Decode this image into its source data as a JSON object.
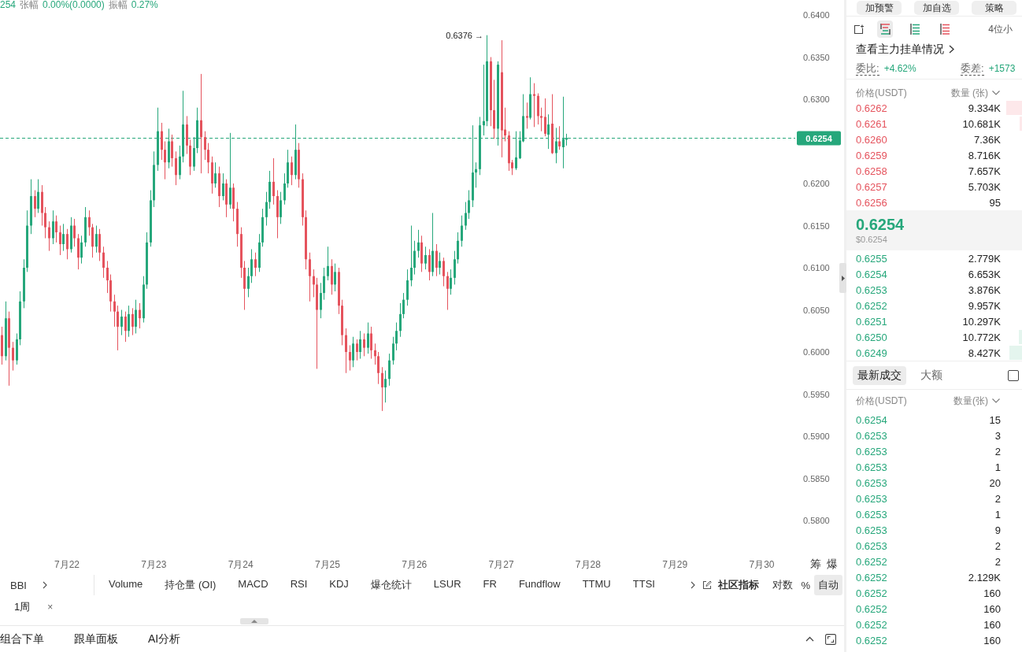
{
  "header": {
    "last": "254",
    "change_label": "张幅",
    "change": "0.00%(0.0000)",
    "amplitude_label": "振幅",
    "amplitude": "0.27%"
  },
  "chart": {
    "chart_data": [
      {
        "type": "candlestick",
        "x": [
          "--07-21T06:00",
          "--07-21T07:00",
          "--07-21T08:00",
          "--07-21T09:00",
          "--07-21T10:00",
          "--07-21T11:00",
          "--07-21T12:00",
          "--07-21T13:00",
          "--07-21T14:00",
          "--07-21T15:00",
          "--07-21T16:00",
          "--07-21T17:00",
          "--07-21T18:00",
          "--07-21T19:00",
          "--07-21T20:00",
          "--07-21T21:00",
          "--07-21T22:00",
          "--07-21T23:00",
          "--07-22T00:00",
          "--07-22T01:00",
          "--07-22T02:00",
          "--07-22T03:00",
          "--07-22T04:00",
          "--07-22T05:00",
          "--07-22T06:00",
          "--07-22T07:00",
          "--07-22T08:00",
          "--07-22T09:00",
          "--07-22T10:00",
          "--07-22T11:00",
          "--07-22T12:00",
          "--07-22T13:00",
          "--07-22T14:00",
          "--07-22T15:00",
          "--07-22T16:00",
          "--07-22T17:00",
          "--07-22T18:00",
          "--07-22T19:00",
          "--07-22T20:00",
          "--07-22T21:00",
          "--07-22T22:00",
          "--07-22T23:00",
          "--07-23T00:00",
          "--07-23T01:00",
          "--07-23T02:00",
          "--07-23T03:00",
          "--07-23T04:00",
          "--07-23T05:00",
          "--07-23T06:00",
          "--07-23T07:00",
          "--07-23T08:00",
          "--07-23T09:00",
          "--07-23T10:00",
          "--07-23T11:00",
          "--07-23T12:00",
          "--07-23T13:00",
          "--07-23T14:00",
          "--07-23T15:00",
          "--07-23T16:00",
          "--07-23T17:00",
          "--07-23T18:00",
          "--07-23T19:00",
          "--07-23T20:00",
          "--07-23T21:00",
          "--07-23T22:00",
          "--07-23T23:00",
          "--07-24T00:00",
          "--07-24T01:00",
          "--07-24T02:00",
          "--07-24T03:00",
          "--07-24T04:00",
          "--07-24T05:00",
          "--07-24T06:00",
          "--07-24T07:00",
          "--07-24T08:00",
          "--07-24T09:00",
          "--07-24T10:00",
          "--07-24T11:00",
          "--07-24T12:00",
          "--07-24T13:00",
          "--07-24T14:00",
          "--07-24T15:00",
          "--07-24T16:00",
          "--07-24T17:00",
          "--07-24T18:00",
          "--07-24T19:00",
          "--07-24T20:00",
          "--07-24T21:00",
          "--07-24T22:00",
          "--07-24T23:00",
          "--07-25T00:00",
          "--07-25T01:00",
          "--07-25T02:00",
          "--07-25T03:00",
          "--07-25T04:00",
          "--07-25T05:00",
          "--07-25T06:00",
          "--07-25T07:00",
          "--07-25T08:00",
          "--07-25T09:00",
          "--07-25T10:00",
          "--07-25T11:00",
          "--07-25T12:00",
          "--07-25T13:00",
          "--07-25T14:00",
          "--07-25T15:00",
          "--07-25T16:00",
          "--07-25T17:00",
          "--07-25T18:00",
          "--07-25T19:00",
          "--07-25T20:00",
          "--07-25T21:00",
          "--07-25T22:00",
          "--07-25T23:00",
          "--07-26T00:00",
          "--07-26T01:00",
          "--07-26T02:00",
          "--07-26T03:00",
          "--07-26T04:00",
          "--07-26T05:00",
          "--07-26T06:00",
          "--07-26T07:00",
          "--07-26T08:00",
          "--07-26T09:00",
          "--07-26T10:00",
          "--07-26T11:00",
          "--07-26T12:00",
          "--07-26T13:00",
          "--07-26T14:00",
          "--07-26T15:00",
          "--07-26T16:00",
          "--07-26T17:00",
          "--07-26T18:00",
          "--07-26T19:00",
          "--07-26T20:00",
          "--07-26T21:00",
          "--07-26T22:00",
          "--07-26T23:00",
          "--07-27T00:00",
          "--07-27T01:00",
          "--07-27T02:00",
          "--07-27T03:00",
          "--07-27T04:00",
          "--07-27T05:00",
          "--07-27T06:00",
          "--07-27T07:00",
          "--07-27T08:00",
          "--07-27T09:00",
          "--07-27T10:00",
          "--07-27T11:00",
          "--07-27T12:00",
          "--07-27T13:00",
          "--07-27T14:00",
          "--07-27T15:00",
          "--07-27T16:00",
          "--07-27T17:00",
          "--07-27T18:00"
        ],
        "ohlc": [
          [
            0.602,
            0.603,
            0.5985,
            0.5995
          ],
          [
            0.5995,
            0.606,
            0.599,
            0.604
          ],
          [
            0.604,
            0.6048,
            0.596,
            0.6005
          ],
          [
            0.6005,
            0.6012,
            0.5978,
            0.599
          ],
          [
            0.599,
            0.6022,
            0.5985,
            0.6015
          ],
          [
            0.6015,
            0.6072,
            0.6008,
            0.606
          ],
          [
            0.606,
            0.611,
            0.6052,
            0.61
          ],
          [
            0.61,
            0.6168,
            0.6095,
            0.615
          ],
          [
            0.615,
            0.6205,
            0.614,
            0.6185
          ],
          [
            0.6185,
            0.6192,
            0.616,
            0.617
          ],
          [
            0.617,
            0.6205,
            0.6165,
            0.619
          ],
          [
            0.619,
            0.6198,
            0.615,
            0.6165
          ],
          [
            0.6165,
            0.6172,
            0.6135,
            0.6148
          ],
          [
            0.6148,
            0.6155,
            0.612,
            0.6135
          ],
          [
            0.6135,
            0.6168,
            0.6128,
            0.6155
          ],
          [
            0.6155,
            0.6162,
            0.613,
            0.6142
          ],
          [
            0.6142,
            0.615,
            0.6115,
            0.6128
          ],
          [
            0.6128,
            0.6152,
            0.612,
            0.614
          ],
          [
            0.614,
            0.6146,
            0.611,
            0.6122
          ],
          [
            0.6122,
            0.616,
            0.6118,
            0.615
          ],
          [
            0.615,
            0.6158,
            0.6125,
            0.6135
          ],
          [
            0.6135,
            0.614,
            0.6098,
            0.6112
          ],
          [
            0.6112,
            0.6138,
            0.6105,
            0.613
          ],
          [
            0.613,
            0.6172,
            0.6125,
            0.616
          ],
          [
            0.616,
            0.6168,
            0.6138,
            0.6148
          ],
          [
            0.6148,
            0.6152,
            0.6112,
            0.6125
          ],
          [
            0.6125,
            0.615,
            0.6118,
            0.614
          ],
          [
            0.614,
            0.6146,
            0.6108,
            0.6118
          ],
          [
            0.6118,
            0.6125,
            0.6088,
            0.61
          ],
          [
            0.61,
            0.6108,
            0.607,
            0.6085
          ],
          [
            0.6085,
            0.6092,
            0.6048,
            0.606
          ],
          [
            0.606,
            0.6068,
            0.603,
            0.6048
          ],
          [
            0.6048,
            0.6055,
            0.6002,
            0.603
          ],
          [
            0.603,
            0.605,
            0.602,
            0.6042
          ],
          [
            0.6042,
            0.6048,
            0.6012,
            0.6025
          ],
          [
            0.6025,
            0.6055,
            0.6018,
            0.6045
          ],
          [
            0.6045,
            0.6052,
            0.602,
            0.603
          ],
          [
            0.603,
            0.6062,
            0.6022,
            0.605
          ],
          [
            0.605,
            0.6058,
            0.6028,
            0.604
          ],
          [
            0.604,
            0.609,
            0.6035,
            0.608
          ],
          [
            0.608,
            0.6142,
            0.6075,
            0.613
          ],
          [
            0.613,
            0.6192,
            0.6125,
            0.618
          ],
          [
            0.618,
            0.6238,
            0.6172,
            0.6222
          ],
          [
            0.6222,
            0.629,
            0.6215,
            0.6262
          ],
          [
            0.6262,
            0.6272,
            0.6228,
            0.624
          ],
          [
            0.624,
            0.625,
            0.6205,
            0.6225
          ],
          [
            0.6225,
            0.6265,
            0.6218,
            0.625
          ],
          [
            0.625,
            0.6258,
            0.622,
            0.623
          ],
          [
            0.623,
            0.6238,
            0.6198,
            0.621
          ],
          [
            0.621,
            0.6245,
            0.6205,
            0.6232
          ],
          [
            0.6232,
            0.631,
            0.6225,
            0.627
          ],
          [
            0.627,
            0.628,
            0.6235,
            0.6245
          ],
          [
            0.6245,
            0.6252,
            0.621,
            0.622
          ],
          [
            0.622,
            0.6255,
            0.6215,
            0.6242
          ],
          [
            0.6242,
            0.629,
            0.6236,
            0.6275
          ],
          [
            0.6275,
            0.633,
            0.6212,
            0.6255
          ],
          [
            0.6255,
            0.6262,
            0.6228,
            0.624
          ],
          [
            0.624,
            0.6248,
            0.6212,
            0.6225
          ],
          [
            0.6225,
            0.6232,
            0.6188,
            0.62
          ],
          [
            0.62,
            0.6225,
            0.6195,
            0.6212
          ],
          [
            0.6212,
            0.622,
            0.6172,
            0.6185
          ],
          [
            0.6185,
            0.6212,
            0.618,
            0.62
          ],
          [
            0.62,
            0.6205,
            0.616,
            0.6175
          ],
          [
            0.6175,
            0.626,
            0.617,
            0.6195
          ],
          [
            0.6195,
            0.62,
            0.6155,
            0.617
          ],
          [
            0.617,
            0.6178,
            0.6125,
            0.614
          ],
          [
            0.614,
            0.6148,
            0.6088,
            0.61
          ],
          [
            0.61,
            0.6108,
            0.605,
            0.6075
          ],
          [
            0.6075,
            0.61,
            0.6065,
            0.609
          ],
          [
            0.609,
            0.6122,
            0.6082,
            0.611
          ],
          [
            0.611,
            0.6118,
            0.609,
            0.61
          ],
          [
            0.61,
            0.614,
            0.6095,
            0.613
          ],
          [
            0.613,
            0.617,
            0.6125,
            0.616
          ],
          [
            0.616,
            0.619,
            0.615,
            0.6178
          ],
          [
            0.6178,
            0.6215,
            0.617,
            0.6202
          ],
          [
            0.6202,
            0.623,
            0.6175,
            0.6185
          ],
          [
            0.6185,
            0.6192,
            0.6135,
            0.616
          ],
          [
            0.616,
            0.619,
            0.6152,
            0.618
          ],
          [
            0.618,
            0.6212,
            0.6175,
            0.62
          ],
          [
            0.62,
            0.624,
            0.6195,
            0.6225
          ],
          [
            0.6225,
            0.6232,
            0.6198,
            0.621
          ],
          [
            0.621,
            0.627,
            0.6205,
            0.624
          ],
          [
            0.624,
            0.6248,
            0.6195,
            0.6205
          ],
          [
            0.6205,
            0.6212,
            0.615,
            0.616
          ],
          [
            0.616,
            0.6168,
            0.6098,
            0.611
          ],
          [
            0.611,
            0.6118,
            0.606,
            0.609
          ],
          [
            0.609,
            0.6098,
            0.6065,
            0.608
          ],
          [
            0.608,
            0.6088,
            0.598,
            0.605
          ],
          [
            0.605,
            0.6082,
            0.604,
            0.607
          ],
          [
            0.607,
            0.61,
            0.6062,
            0.609
          ],
          [
            0.609,
            0.6125,
            0.6085,
            0.6102
          ],
          [
            0.6102,
            0.611,
            0.6068,
            0.608
          ],
          [
            0.608,
            0.6105,
            0.6072,
            0.6095
          ],
          [
            0.6095,
            0.61,
            0.6045,
            0.6055
          ],
          [
            0.6055,
            0.6062,
            0.6008,
            0.602
          ],
          [
            0.602,
            0.6028,
            0.5975,
            0.6
          ],
          [
            0.6,
            0.6008,
            0.5978,
            0.599
          ],
          [
            0.599,
            0.6018,
            0.5982,
            0.601
          ],
          [
            0.601,
            0.6015,
            0.599,
            0.6
          ],
          [
            0.6,
            0.6025,
            0.5992,
            0.6015
          ],
          [
            0.6015,
            0.6022,
            0.5995,
            0.6005
          ],
          [
            0.6005,
            0.6035,
            0.5998,
            0.6022
          ],
          [
            0.6022,
            0.603,
            0.5992,
            0.6002
          ],
          [
            0.6002,
            0.601,
            0.5985,
            0.5995
          ],
          [
            0.5995,
            0.6,
            0.5962,
            0.5975
          ],
          [
            0.5975,
            0.5982,
            0.593,
            0.5958
          ],
          [
            0.5958,
            0.5978,
            0.594,
            0.5968
          ],
          [
            0.5968,
            0.5998,
            0.596,
            0.599
          ],
          [
            0.599,
            0.6018,
            0.5985,
            0.601
          ],
          [
            0.601,
            0.6035,
            0.6002,
            0.6025
          ],
          [
            0.6025,
            0.6058,
            0.6018,
            0.6045
          ],
          [
            0.6045,
            0.607,
            0.604,
            0.6062
          ],
          [
            0.6062,
            0.6098,
            0.6055,
            0.6085
          ],
          [
            0.6085,
            0.615,
            0.6078,
            0.61
          ],
          [
            0.61,
            0.6132,
            0.6092,
            0.612
          ],
          [
            0.612,
            0.6145,
            0.6112,
            0.613
          ],
          [
            0.613,
            0.6138,
            0.6095,
            0.6105
          ],
          [
            0.6105,
            0.6125,
            0.6098,
            0.6115
          ],
          [
            0.6115,
            0.6122,
            0.6085,
            0.6095
          ],
          [
            0.6095,
            0.6165,
            0.609,
            0.612
          ],
          [
            0.612,
            0.6128,
            0.609,
            0.61
          ],
          [
            0.61,
            0.6118,
            0.6092,
            0.6108
          ],
          [
            0.6108,
            0.6112,
            0.6078,
            0.609
          ],
          [
            0.609,
            0.6095,
            0.605,
            0.6075
          ],
          [
            0.6075,
            0.6098,
            0.6068,
            0.6088
          ],
          [
            0.6088,
            0.612,
            0.608,
            0.611
          ],
          [
            0.611,
            0.6142,
            0.6105,
            0.6132
          ],
          [
            0.6132,
            0.6162,
            0.6125,
            0.615
          ],
          [
            0.615,
            0.6178,
            0.6145,
            0.6165
          ],
          [
            0.6165,
            0.6192,
            0.6158,
            0.618
          ],
          [
            0.618,
            0.6269,
            0.6172,
            0.6213
          ],
          [
            0.6213,
            0.6225,
            0.6195,
            0.6217
          ],
          [
            0.6217,
            0.6279,
            0.621,
            0.6269
          ],
          [
            0.6269,
            0.6341,
            0.6257,
            0.6274
          ],
          [
            0.6274,
            0.6376,
            0.6268,
            0.6345
          ],
          [
            0.6345,
            0.635,
            0.6268,
            0.6287
          ],
          [
            0.6287,
            0.6323,
            0.6253,
            0.6265
          ],
          [
            0.6265,
            0.6345,
            0.6245,
            0.6341
          ],
          [
            0.6332,
            0.637,
            0.6231,
            0.6263
          ],
          [
            0.6264,
            0.629,
            0.625,
            0.6257
          ],
          [
            0.6257,
            0.6262,
            0.6215,
            0.6224
          ],
          [
            0.6225,
            0.6228,
            0.621,
            0.6218
          ],
          [
            0.6218,
            0.6262,
            0.6216,
            0.6231
          ],
          [
            0.623,
            0.6262,
            0.6229,
            0.6251
          ],
          [
            0.625,
            0.6306,
            0.6249,
            0.628
          ],
          [
            0.628,
            0.6296,
            0.6265,
            0.6278
          ],
          [
            0.6278,
            0.6326,
            0.6276,
            0.6306
          ],
          [
            0.6306,
            0.6319,
            0.6267,
            0.6304
          ],
          [
            0.6304,
            0.6307,
            0.627,
            0.628
          ],
          [
            0.628,
            0.629,
            0.6262,
            0.6278
          ],
          [
            0.6279,
            0.6301,
            0.6256,
            0.6259
          ],
          [
            0.6258,
            0.6282,
            0.6241,
            0.627
          ],
          [
            0.6271,
            0.6306,
            0.6235,
            0.6236
          ],
          [
            0.6236,
            0.6266,
            0.6224,
            0.625
          ],
          [
            0.625,
            0.6268,
            0.624,
            0.6244
          ],
          [
            0.6243,
            0.6303,
            0.6218,
            0.6253
          ],
          [
            0.6252,
            0.6259,
            0.6245,
            0.6254
          ]
        ],
        "xlim": [
          "--07-21T05:30",
          "--07-30T09:15"
        ],
        "xticks": [
          {
            "value": "--07-22T00:00",
            "label": "7月22"
          },
          {
            "value": "--07-23T00:00",
            "label": "7月23"
          },
          {
            "value": "--07-24T00:00",
            "label": "7月24"
          },
          {
            "value": "--07-25T00:00",
            "label": "7月25"
          },
          {
            "value": "--07-26T00:00",
            "label": "7月26"
          },
          {
            "value": "--07-27T00:00",
            "label": "7月27"
          },
          {
            "value": "--07-28T00:00",
            "label": "7月28"
          },
          {
            "value": "--07-29T00:00",
            "label": "7月29"
          },
          {
            "value": "--07-30T00:00",
            "label": "7月30"
          }
        ],
        "ylim": [
          0.58,
          0.64
        ],
        "yticks": [
          {
            "value": 0.64,
            "label": "0.6400"
          },
          {
            "value": 0.635,
            "label": "0.6350"
          },
          {
            "value": 0.63,
            "label": "0.6300"
          },
          {
            "value": 0.62,
            "label": "0.6200"
          },
          {
            "value": 0.615,
            "label": "0.6150"
          },
          {
            "value": 0.61,
            "label": "0.6100"
          },
          {
            "value": 0.605,
            "label": "0.6050"
          },
          {
            "value": 0.6,
            "label": "0.6000"
          },
          {
            "value": 0.595,
            "label": "0.5950"
          },
          {
            "value": 0.59,
            "label": "0.5900"
          },
          {
            "value": 0.585,
            "label": "0.5850"
          },
          {
            "value": 0.58,
            "label": "0.5800"
          }
        ],
        "ref_lines": [
          {
            "axis": "y",
            "value": 0.6254,
            "label": "0.6254",
            "color": "#26a77b",
            "line_style": "dashed"
          }
        ],
        "annotations": [
          "0.6376 →"
        ]
      }
    ],
    "corner_buttons": [
      "筹",
      "爆"
    ]
  },
  "indicator_bar": {
    "main_indicator": "BBI",
    "indicators": [
      "Volume",
      "持仓量 (OI)",
      "MACD",
      "RSI",
      "KDJ",
      "爆仓统计",
      "LSUR",
      "FR",
      "Fundflow",
      "TTMU",
      "TTSI"
    ],
    "community": "社区指标",
    "scale_options": [
      {
        "label": "对数",
        "selected": false
      },
      {
        "label": "%",
        "selected": false
      },
      {
        "label": "自动",
        "selected": true
      }
    ]
  },
  "interval_bar": {
    "interval": "1周",
    "close": "×"
  },
  "bottom_tabs": [
    "组合下单",
    "跟单面板",
    "AI分析"
  ],
  "order_panel": {
    "actions": [
      "加预警",
      "加自选",
      "策略"
    ],
    "layouts": [
      {
        "kind": "both",
        "selected": true
      },
      {
        "kind": "bids",
        "selected": false
      },
      {
        "kind": "asks",
        "selected": false
      }
    ],
    "precision": "4位小",
    "main_orders_link": "查看主力挂单情况",
    "ratio_label": "委比:",
    "ratio": "+4.62%",
    "diff_label": "委差:",
    "diff": "+1573",
    "book_columns": [
      "价格(USDT)",
      "数量 (张)"
    ],
    "asks": [
      {
        "price": "0.6262",
        "qty": "9.334K",
        "level": 0.09
      },
      {
        "price": "0.6261",
        "qty": "10.681K",
        "level": 0.015
      },
      {
        "price": "0.6260",
        "qty": "7.36K"
      },
      {
        "price": "0.6259",
        "qty": "8.716K"
      },
      {
        "price": "0.6258",
        "qty": "7.657K"
      },
      {
        "price": "0.6257",
        "qty": "5.703K"
      },
      {
        "price": "0.6256",
        "qty": "95"
      }
    ],
    "mid": {
      "price": "0.6254",
      "usd": "$0.6254"
    },
    "bids": [
      {
        "price": "0.6255",
        "qty": "2.779K"
      },
      {
        "price": "0.6254",
        "qty": "6.653K"
      },
      {
        "price": "0.6253",
        "qty": "3.876K"
      },
      {
        "price": "0.6252",
        "qty": "9.957K"
      },
      {
        "price": "0.6251",
        "qty": "10.297K"
      },
      {
        "price": "0.6250",
        "qty": "10.772K",
        "level": 0.02
      },
      {
        "price": "0.6249",
        "qty": "8.427K",
        "level": 0.07
      }
    ],
    "trade_tabs": [
      {
        "label": "最新成交",
        "selected": true
      },
      {
        "label": "大额",
        "selected": false
      }
    ],
    "checkbox": {
      "checked": false
    },
    "trade_columns": [
      "价格(USDT)",
      "数量(张)"
    ],
    "trades": [
      {
        "price": "0.6254",
        "qty": "15"
      },
      {
        "price": "0.6253",
        "qty": "3"
      },
      {
        "price": "0.6253",
        "qty": "2"
      },
      {
        "price": "0.6253",
        "qty": "1"
      },
      {
        "price": "0.6253",
        "qty": "20"
      },
      {
        "price": "0.6253",
        "qty": "2"
      },
      {
        "price": "0.6253",
        "qty": "1"
      },
      {
        "price": "0.6253",
        "qty": "9"
      },
      {
        "price": "0.6253",
        "qty": "2"
      },
      {
        "price": "0.6252",
        "qty": "2"
      },
      {
        "price": "0.6252",
        "qty": "2.129K"
      },
      {
        "price": "0.6252",
        "qty": "160"
      },
      {
        "price": "0.6252",
        "qty": "160"
      },
      {
        "price": "0.6252",
        "qty": "160"
      },
      {
        "price": "0.6252",
        "qty": "160"
      }
    ]
  }
}
